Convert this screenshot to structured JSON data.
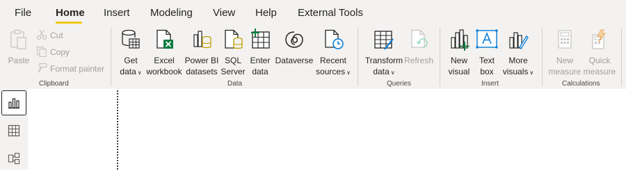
{
  "menu": {
    "tabs": [
      {
        "label": "File"
      },
      {
        "label": "Home"
      },
      {
        "label": "Insert"
      },
      {
        "label": "Modeling"
      },
      {
        "label": "View"
      },
      {
        "label": "Help"
      },
      {
        "label": "External Tools"
      }
    ],
    "active_tab": "Home",
    "accent_color": "#f2c811"
  },
  "ribbon": {
    "clipboard": {
      "group_label": "Clipboard",
      "paste": "Paste",
      "cut": "Cut",
      "copy": "Copy",
      "format_painter": "Format painter"
    },
    "data": {
      "group_label": "Data",
      "get_data": {
        "line1": "Get",
        "line2": "data"
      },
      "excel": {
        "line1": "Excel",
        "line2": "workbook"
      },
      "powerbi": {
        "line1": "Power BI",
        "line2": "datasets"
      },
      "sql": {
        "line1": "SQL",
        "line2": "Server"
      },
      "enter_data": {
        "line1": "Enter",
        "line2": "data"
      },
      "dataverse": {
        "line1": "Dataverse"
      },
      "recent": {
        "line1": "Recent",
        "line2": "sources"
      }
    },
    "queries": {
      "group_label": "Queries",
      "transform": {
        "line1": "Transform",
        "line2": "data"
      },
      "refresh": {
        "line1": "Refresh"
      }
    },
    "insert": {
      "group_label": "Insert",
      "new_visual": {
        "line1": "New",
        "line2": "visual"
      },
      "text_box": {
        "line1": "Text",
        "line2": "box"
      },
      "more_visuals": {
        "line1": "More",
        "line2": "visuals"
      }
    },
    "calculations": {
      "group_label": "Calculations",
      "new_measure": {
        "line1": "New",
        "line2": "measure"
      },
      "quick_measure": {
        "line1": "Quick",
        "line2": "measure"
      }
    }
  },
  "left_nav": {
    "items": [
      "report-view",
      "table-view",
      "model-view"
    ],
    "active": "report-view"
  }
}
